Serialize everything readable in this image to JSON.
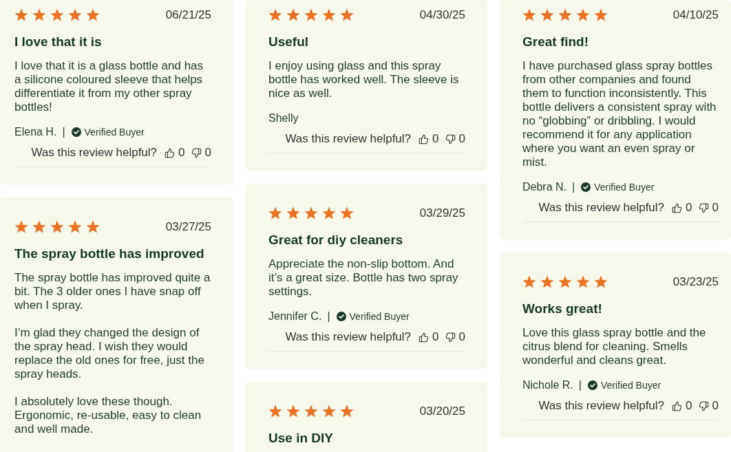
{
  "columns": [
    {
      "reviews": [
        {
          "stars": 5,
          "date": "06/21/25",
          "title": "I love that it is",
          "body": [
            "I love that it is a glass bottle and has a silicone coloured sleeve that helps differentiate it from my other spray bottles!"
          ],
          "author": "Elena H.",
          "separator": "|",
          "verified": true,
          "verified_label": "Verified Buyer",
          "helpful": {
            "label": "Was this review helpful?",
            "up": "0",
            "down": "0"
          }
        },
        {
          "stars": 5,
          "date": "03/27/25",
          "title": "The spray bottle has improved",
          "body": [
            "The spray bottle has improved quite a bit. The 3 older ones I have snap off when I spray.",
            "I’m glad they changed the design of the spray head. I wish they would replace the old ones for free, just the spray heads.",
            "I absolutely love these though. Ergonomic, re-usable, easy to clean and well made."
          ]
        }
      ]
    },
    {
      "reviews": [
        {
          "stars": 5,
          "date": "04/30/25",
          "title": "Useful",
          "body": [
            "I enjoy using glass and this spray bottle has worked well. The sleeve is nice as well."
          ],
          "author": "Shelly",
          "verified": false,
          "helpful": {
            "label": "Was this review helpful?",
            "up": "0",
            "down": "0"
          }
        },
        {
          "stars": 5,
          "date": "03/29/25",
          "title": "Great for diy cleaners",
          "body": [
            "Appreciate the non-slip bottom. And it’s a great size. Bottle has two spray settings."
          ],
          "author": "Jennifer C.",
          "separator": "|",
          "verified": true,
          "verified_label": "Verified Buyer",
          "helpful": {
            "label": "Was this review helpful?",
            "up": "0",
            "down": "0"
          }
        },
        {
          "stars": 5,
          "date": "03/20/25",
          "title": "Use in DIY"
        }
      ]
    },
    {
      "reviews": [
        {
          "stars": 5,
          "date": "04/10/25",
          "title": "Great find!",
          "body": [
            "I have purchased glass spray bottles from other companies and found them to function inconsistently. This bottle delivers a consistent spray with no “globbing” or dribbling. I would recommend it for any application where you want an even spray or mist."
          ],
          "author": "Debra N.",
          "separator": "|",
          "verified": true,
          "verified_label": "Verified Buyer",
          "helpful": {
            "label": "Was this review helpful?",
            "up": "0",
            "down": "0"
          }
        },
        {
          "stars": 5,
          "date": "03/23/25",
          "title": "Works great!",
          "body": [
            "Love this glass spray bottle and the citrus blend for cleaning. Smells wonderful and cleans great."
          ],
          "author": "Nichole R.",
          "separator": "|",
          "verified": true,
          "verified_label": "Verified Buyer",
          "helpful": {
            "label": "Was this review helpful?",
            "up": "0",
            "down": "0"
          }
        }
      ]
    }
  ]
}
